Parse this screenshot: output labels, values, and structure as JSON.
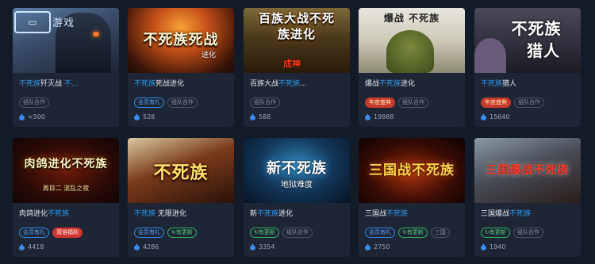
{
  "cards": [
    {
      "id": "c1",
      "thumb_text": "",
      "thumb_sub": "",
      "name_parts": [
        {
          "t": "不死族",
          "hl": true
        },
        {
          "t": "歼灭战 ",
          "hl": false
        },
        {
          "t": "不...",
          "hl": true
        }
      ],
      "tags": [
        {
          "label": "组队合作",
          "kind": "plain"
        }
      ],
      "heat": "<500",
      "logo_text": "游戏"
    },
    {
      "id": "c2",
      "thumb_text": "不死族死战",
      "thumb_sub": "进化",
      "name_parts": [
        {
          "t": "不死族",
          "hl": true
        },
        {
          "t": "死战进化",
          "hl": false
        }
      ],
      "tags": [
        {
          "label": "会员有礼",
          "kind": "member"
        },
        {
          "label": "组队合作",
          "kind": "plain"
        }
      ],
      "heat": "528"
    },
    {
      "id": "c3",
      "thumb_text": "百族大战不死",
      "thumb_sub": "族进化",
      "name_parts": [
        {
          "t": "百族大战",
          "hl": false
        },
        {
          "t": "不死族",
          "hl": true
        },
        {
          "t": "...",
          "hl": false
        }
      ],
      "tags": [
        {
          "label": "组队合作",
          "kind": "plain"
        }
      ],
      "heat": "588"
    },
    {
      "id": "c4",
      "thumb_text": "爆战 不死族",
      "thumb_sub": "",
      "name_parts": [
        {
          "t": "爆战",
          "hl": false
        },
        {
          "t": "不死族",
          "hl": true
        },
        {
          "t": "进化",
          "hl": false
        }
      ],
      "tags": [
        {
          "label": "年度盛典",
          "kind": "year"
        },
        {
          "label": "组队合作",
          "kind": "plain"
        }
      ],
      "heat": "19988"
    },
    {
      "id": "c5",
      "thumb_text": "不死族",
      "thumb_sub": "猎人",
      "name_parts": [
        {
          "t": "不死族",
          "hl": true
        },
        {
          "t": "猎人",
          "hl": false
        }
      ],
      "tags": [
        {
          "label": "年度盛典",
          "kind": "year"
        },
        {
          "label": "组队合作",
          "kind": "plain"
        }
      ],
      "heat": "15640"
    },
    {
      "id": "c6",
      "thumb_text": "肉鸽进化不死族",
      "thumb_sub": "周目二 混乱之夜",
      "name_parts": [
        {
          "t": "肉鸽进化",
          "hl": false
        },
        {
          "t": "不死族",
          "hl": true
        }
      ],
      "tags": [
        {
          "label": "会员有礼",
          "kind": "member"
        },
        {
          "label": "双倍福利",
          "kind": "double"
        }
      ],
      "heat": "4418"
    },
    {
      "id": "c7",
      "thumb_text": "不死族",
      "thumb_sub": "",
      "name_parts": [
        {
          "t": "不死族",
          "hl": true
        },
        {
          "t": " 无限进化",
          "hl": false
        }
      ],
      "tags": [
        {
          "label": "会员有礼",
          "kind": "member"
        },
        {
          "label": "有更新",
          "kind": "update"
        }
      ],
      "heat": "4286"
    },
    {
      "id": "c8",
      "thumb_text": "新不死族",
      "thumb_sub": "地狱难度",
      "name_parts": [
        {
          "t": "新",
          "hl": false
        },
        {
          "t": "不死族",
          "hl": true
        },
        {
          "t": "进化",
          "hl": false
        }
      ],
      "tags": [
        {
          "label": "有更新",
          "kind": "update"
        },
        {
          "label": "组队合作",
          "kind": "plain"
        }
      ],
      "heat": "3354"
    },
    {
      "id": "c9",
      "thumb_text": "三国战不死族",
      "thumb_sub": "",
      "name_parts": [
        {
          "t": "三国战",
          "hl": false
        },
        {
          "t": "不死族",
          "hl": true
        }
      ],
      "tags": [
        {
          "label": "会员有礼",
          "kind": "member"
        },
        {
          "label": "有更新",
          "kind": "update"
        },
        {
          "label": "三国",
          "kind": "plain"
        }
      ],
      "heat": "2750"
    },
    {
      "id": "c10",
      "thumb_text": "三国爆战不死族",
      "thumb_sub": "",
      "name_parts": [
        {
          "t": "三国爆战",
          "hl": false
        },
        {
          "t": "不死族",
          "hl": true
        }
      ],
      "tags": [
        {
          "label": "有更新",
          "kind": "update"
        },
        {
          "label": "组队合作",
          "kind": "plain"
        }
      ],
      "heat": "1940"
    }
  ],
  "colors": {
    "highlight": "#2d9cf5",
    "card_bg": "#1e2636",
    "page_bg": "#141b28",
    "member_tag": "#2d8cf0",
    "update_tag": "#2fb35c",
    "year_tag": "#c63a2b"
  },
  "icons": {
    "heat": "flame-icon",
    "update": "refresh-icon"
  }
}
